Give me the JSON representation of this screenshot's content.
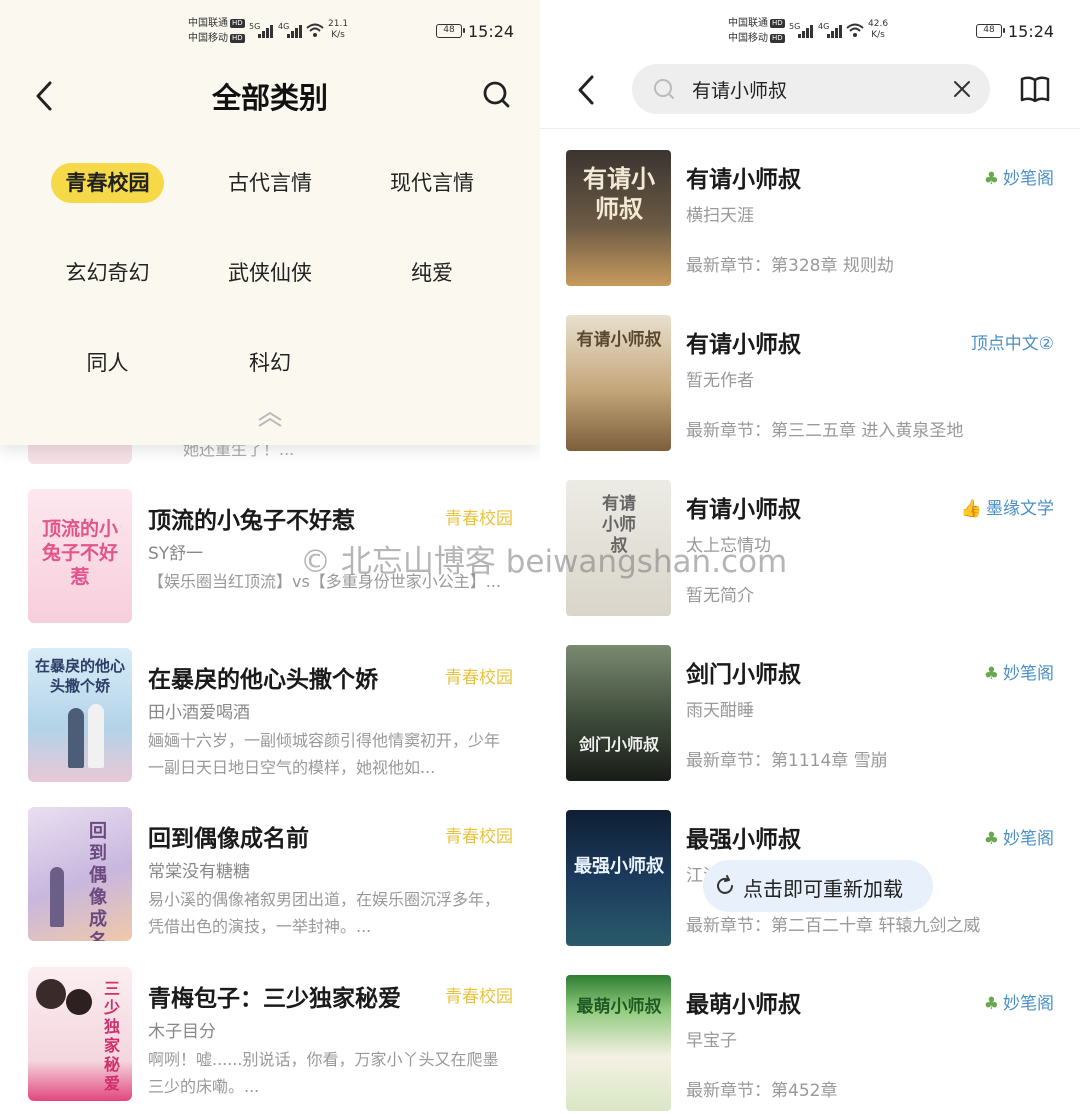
{
  "left": {
    "status": {
      "carrier1": "中国联通",
      "carrier2": "中国移动",
      "net1": "5G",
      "net2": "4G",
      "speed_value": "21.1",
      "speed_unit": "K/s",
      "battery": "48",
      "time": "15:24"
    },
    "header": {
      "title": "全部类别"
    },
    "categories": [
      {
        "label": "青春校园",
        "active": true
      },
      {
        "label": "古代言情",
        "active": false
      },
      {
        "label": "现代言情",
        "active": false
      },
      {
        "label": "玄幻奇幻",
        "active": false
      },
      {
        "label": "武侠仙侠",
        "active": false
      },
      {
        "label": "纯爱",
        "active": false
      },
      {
        "label": "同人",
        "active": false
      },
      {
        "label": "科幻",
        "active": false
      }
    ],
    "partial_desc": "她还重生了！...",
    "books": [
      {
        "title": "顶流的小兔子不好惹",
        "tag": "青春校园",
        "author": "SY舒一",
        "desc": "【娱乐圈当红顶流】vs【多重身份世家小公主】...",
        "cover_text": "顶流的小兔子不好惹",
        "cover_color": "#f7d3df"
      },
      {
        "title": "在暴戾的他心头撒个娇",
        "tag": "青春校园",
        "author": "田小酒爱喝酒",
        "desc": "婳婳十六岁，一副倾城容颜引得他情窦初开，少年一副日天日地日空气的模样，她视他如...",
        "cover_text": "在暴戾的他心头撒个娇",
        "cover_color": "#bfdcef"
      },
      {
        "title": "回到偶像成名前",
        "tag": "青春校园",
        "author": "常棠没有糖糖",
        "desc": "易小溪的偶像褚叙男团出道，在娱乐圈沉浮多年，凭借出色的演技，一举封神。...",
        "cover_text": "回到偶像成名前",
        "cover_color": "#d7c3e4"
      },
      {
        "title": "青梅包子：三少独家秘爱",
        "tag": "青春校园",
        "author": "木子目分",
        "desc": "啊咧！嘘......别说话，你看，万家小丫头又在爬墨三少的床嘞。...",
        "cover_text": "三少独家秘爱",
        "cover_color": "#f3dfe4"
      }
    ]
  },
  "right": {
    "status": {
      "carrier1": "中国联通",
      "carrier2": "中国移动",
      "net1": "5G",
      "net2": "4G",
      "speed_value": "42.6",
      "speed_unit": "K/s",
      "battery": "48",
      "time": "15:24"
    },
    "search": {
      "value": "有请小师叔"
    },
    "results": [
      {
        "title": "有请小师叔",
        "author": "横扫天涯",
        "latest": "最新章节：第328章 规则劫",
        "source": "妙笔阁",
        "source_icon": "clover-icon",
        "cover_text": "有请小师叔",
        "cover_color": "#5a4a3a"
      },
      {
        "title": "有请小师叔",
        "author": "暂无作者",
        "latest": "最新章节：第三二五章 进入黄泉圣地",
        "source": "顶点中文②",
        "source_icon": "",
        "cover_text": "有请小师叔",
        "cover_color": "#b89770"
      },
      {
        "title": "有请小师叔",
        "author": "太上忘情功",
        "latest": "暂无简介",
        "source": "墨缘文学",
        "source_icon": "thumbs-up-icon",
        "cover_text": "有请小师叔",
        "cover_color": "#e4e0d6"
      },
      {
        "title": "剑门小师叔",
        "author": "雨天酣睡",
        "latest": "最新章节：第1114章 雪崩",
        "source": "妙笔阁",
        "source_icon": "clover-icon",
        "cover_text": "剑门小师叔",
        "cover_color": "#3d4a3a"
      },
      {
        "title": "最强小师叔",
        "author": "江流清风",
        "latest": "最新章节：第二百二十章 轩辕九剑之威",
        "source": "妙笔阁",
        "source_icon": "clover-icon",
        "cover_text": "最强小师叔",
        "cover_color": "#1c3350"
      },
      {
        "title": "最萌小师叔",
        "author": "早宝子",
        "latest": "最新章节：第452章",
        "source": "妙笔阁",
        "source_icon": "clover-icon",
        "cover_text": "最萌小师叔",
        "cover_color": "#8fc97c"
      }
    ],
    "toast": {
      "label": "点击即可重新加载"
    }
  },
  "watermark": "© 北忘山博客 beiwangshan.com",
  "colors": {
    "accent_yellow": "#f6d948",
    "tag_yellow": "#e7c43f",
    "source_blue": "#4a8fc8",
    "panel_bg": "#fbf9ef"
  }
}
